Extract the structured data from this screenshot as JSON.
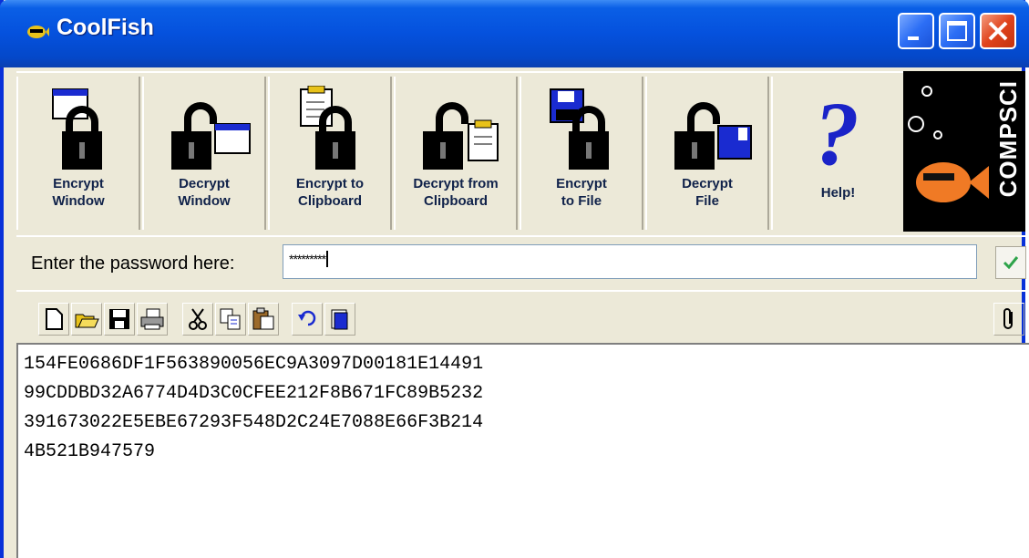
{
  "window": {
    "title": "CoolFish"
  },
  "toolbar": {
    "buttons": [
      {
        "label": "Encrypt\nWindow"
      },
      {
        "label": "Decrypt\nWindow"
      },
      {
        "label": "Encrypt to\nClipboard"
      },
      {
        "label": "Decrypt from\nClipboard"
      },
      {
        "label": "Encrypt\nto File"
      },
      {
        "label": "Decrypt\nFile"
      },
      {
        "label": "Help!"
      }
    ],
    "logo_text": "COMPSCI"
  },
  "password": {
    "label": "Enter the password here:",
    "value": "*********"
  },
  "editor": {
    "lines": [
      "154FE0686DF1F563890056EC9A3097D00181E14491",
      "99CDDBD32A6774D4D3C0CFEE212F8B671FC89B5232",
      "391673022E5EBE67293F548D2C24E7088E66F3B214",
      "4B521B947579"
    ]
  },
  "icons": {
    "title": "fish-icon",
    "toolbar": [
      "encrypt-window-icon",
      "decrypt-window-icon",
      "encrypt-clipboard-icon",
      "decrypt-clipboard-icon",
      "encrypt-file-icon",
      "decrypt-file-icon",
      "help-icon"
    ],
    "iconbar": [
      "new-icon",
      "open-icon",
      "save-icon",
      "print-icon",
      "cut-icon",
      "copy-icon",
      "paste-icon",
      "undo-icon",
      "select-all-icon",
      "attach-icon"
    ]
  }
}
